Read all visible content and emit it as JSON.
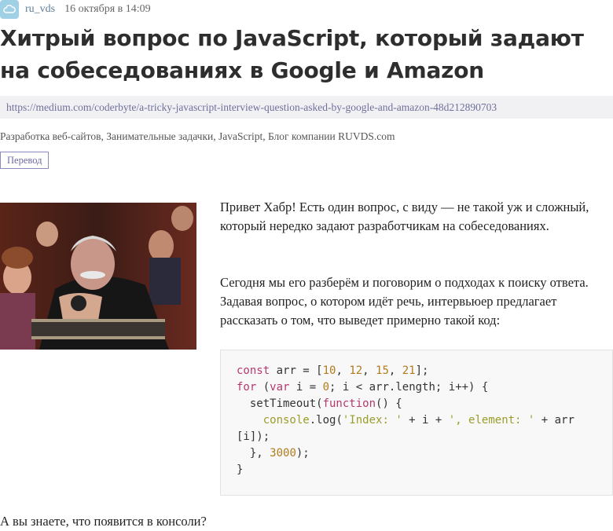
{
  "author": {
    "name": "ru_vds",
    "date": "16 октября в 14:09"
  },
  "article": {
    "title": "Хитрый вопрос по JavaScript, который задают на собеседованиях в Google и Amazon",
    "source_url": "https://medium.com/coderbyte/a-tricky-javascript-interview-question-asked-by-google-and-amazon-48d212890703",
    "hubs": [
      "Разработка веб-сайтов,",
      "Занимательные задачки,",
      "JavaScript,",
      "Блог компании RUVDS.com"
    ],
    "label": "Перевод",
    "p1": "Привет Хабр! Есть один вопрос, с виду — не такой уж и сложный, который нередко задают разработчикам на собеседованиях.",
    "p2": "Сегодня мы его разберём и поговорим о подходах к поиску ответа. Задавая вопрос, о котором идёт речь, интервьюер предлагает рассказать о том, что выведет примерно такой код:",
    "p3": "А вы знаете, что появится в консоли?"
  },
  "code_lines": [
    "const arr = [10, 12, 15, 21];",
    "for (var i = 0; i < arr.length; i++) {",
    "  setTimeout(function() {",
    "    console.log('Index: ' + i + ', element: ' + arr",
    "[i]);",
    "  }, 3000);",
    "}"
  ],
  "colors": {
    "author": "#5e7e99",
    "link": "#6f6f9b",
    "keyword": "#b5386f",
    "number": "#b07c1e",
    "string": "#9a9d2a"
  }
}
